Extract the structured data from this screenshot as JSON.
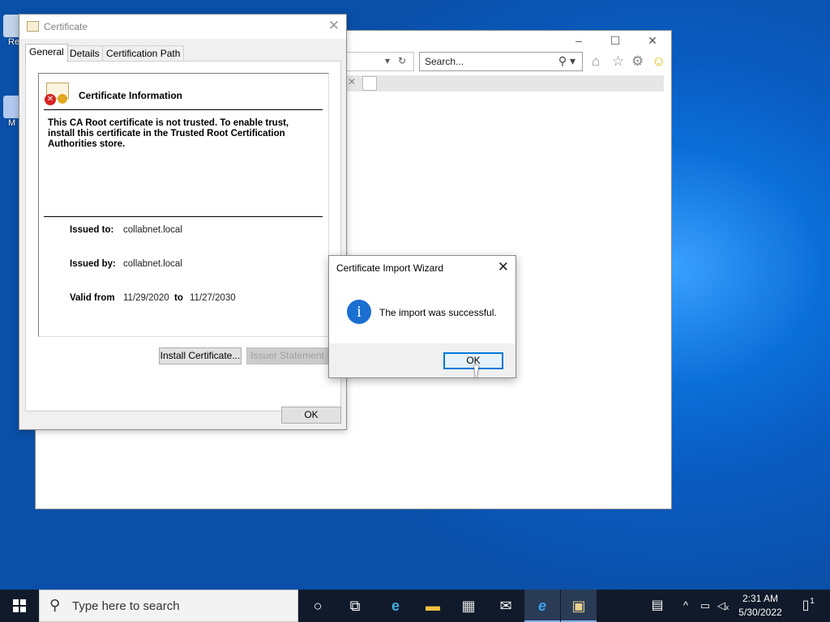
{
  "desktop": {
    "icons": [
      {
        "name": "recycle-bin",
        "label": "Re"
      },
      {
        "name": "ms-icon",
        "label": "M"
      }
    ]
  },
  "ie_window": {
    "minimize": "–",
    "maximize": "☐",
    "close": "✕",
    "address_dropdown": "▾",
    "refresh": "↻",
    "search_placeholder": "Search...",
    "search_icon": "⚲ ▾",
    "tab_close": "✕"
  },
  "certificate_dialog": {
    "title": "Certificate",
    "close": "✕",
    "tabs": [
      "General",
      "Details",
      "Certification Path"
    ],
    "header": "Certificate Information",
    "warning": "This CA Root certificate is not trusted. To enable trust, install this certificate in the Trusted Root Certification Authorities store.",
    "issued_to_label": "Issued to:",
    "issued_to_value": "collabnet.local",
    "issued_by_label": "Issued by:",
    "issued_by_value": "collabnet.local",
    "valid_from_label": "Valid from",
    "valid_from": "11/29/2020",
    "to_label": "to",
    "valid_to": "11/27/2030",
    "install_button": "Install Certificate...",
    "issuer_button": "Issuer Statement",
    "ok_button": "OK"
  },
  "wizard": {
    "title": "Certificate Import Wizard",
    "close": "✕",
    "info_glyph": "i",
    "message": "The import was successful.",
    "ok_button": "OK"
  },
  "taskbar": {
    "search_placeholder": "Type here to search",
    "search_glyph": "⚲",
    "cortana_glyph": "○",
    "taskview_glyph": "⧉",
    "edge_glyph": "e",
    "explorer_glyph": "▬",
    "store_glyph": "▦",
    "mail_glyph": "✉",
    "ie_glyph": "e",
    "cert_glyph": "▣",
    "news_glyph": "▤",
    "chevron_glyph": "^",
    "network_glyph": "▭",
    "volume_glyph": "◁ₓ",
    "notification_glyph": "▯",
    "time": "2:31 AM",
    "date": "5/30/2022",
    "notification_count": "1"
  }
}
